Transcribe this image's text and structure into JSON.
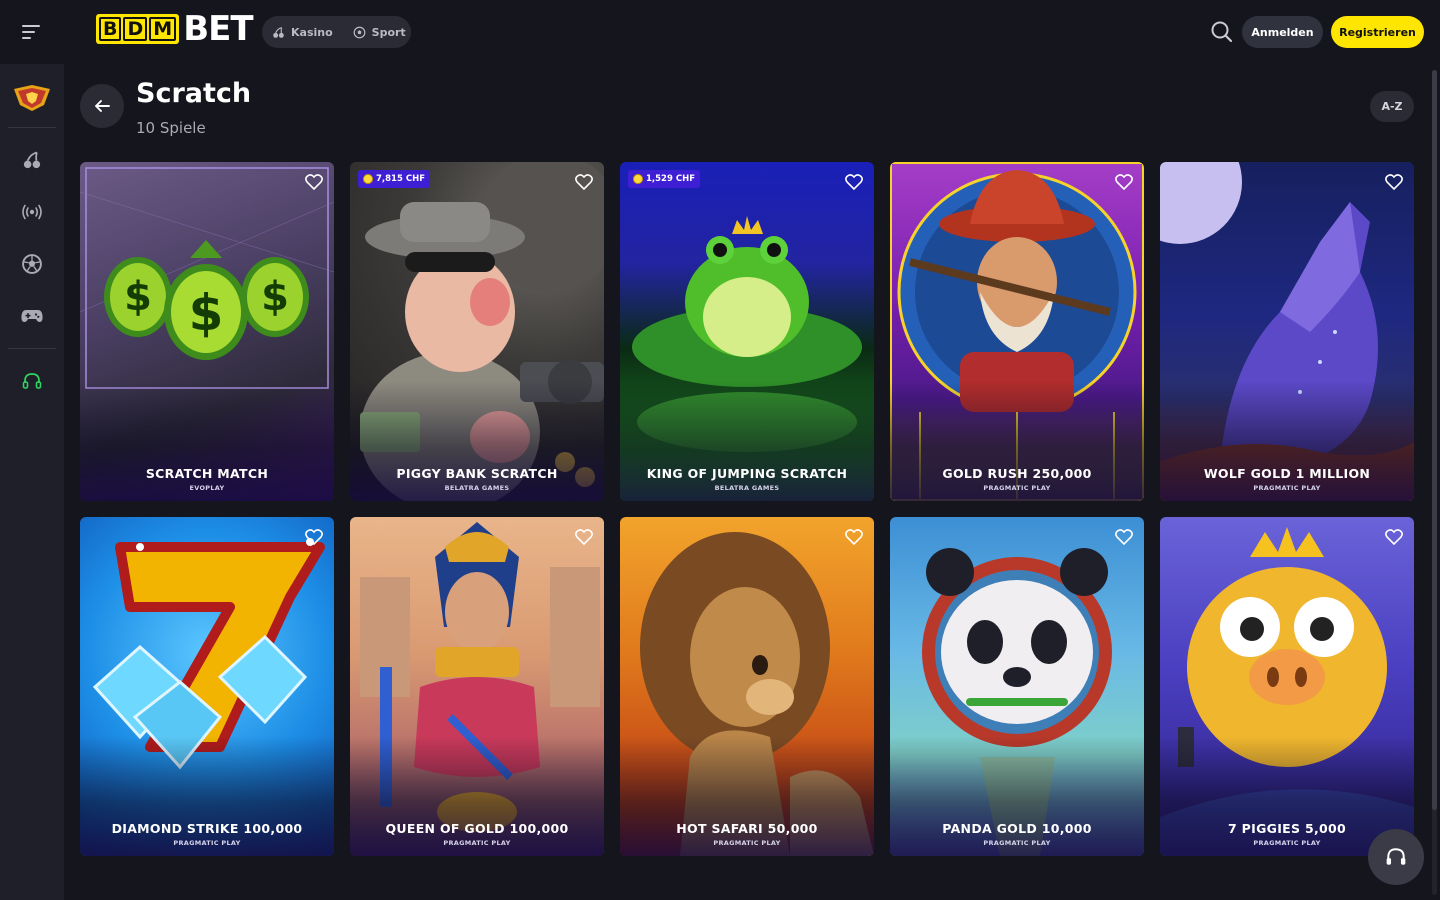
{
  "header": {
    "logo_prefix": [
      "B",
      "D",
      "M"
    ],
    "logo_suffix": "BET",
    "nav": [
      {
        "label": "Kasino",
        "icon": "cherry-icon"
      },
      {
        "label": "Sport",
        "icon": "soccer-ball-icon"
      }
    ],
    "login_label": "Anmelden",
    "register_label": "Registrieren"
  },
  "sidebar": {
    "items": [
      "promo-badge-icon",
      "cherry-icon",
      "live-broadcast-icon",
      "soccer-ball-icon",
      "gamepad-icon",
      "headset-icon"
    ]
  },
  "page": {
    "title": "Scratch",
    "subtitle": "10 Spiele",
    "sort_label": "A-Z"
  },
  "games": [
    {
      "name": "SCRATCH MATCH",
      "provider": "EVOPLAY",
      "jackpot": ""
    },
    {
      "name": "PIGGY BANK SCRATCH",
      "provider": "BELATRA GAMES",
      "jackpot": "7,815 CHF"
    },
    {
      "name": "KING OF JUMPING SCRATCH",
      "provider": "BELATRA GAMES",
      "jackpot": "1,529 CHF"
    },
    {
      "name": "GOLD RUSH 250,000",
      "provider": "PRAGMATIC PLAY",
      "jackpot": ""
    },
    {
      "name": "WOLF GOLD 1 MILLION",
      "provider": "PRAGMATIC PLAY",
      "jackpot": ""
    },
    {
      "name": "DIAMOND STRIKE 100,000",
      "provider": "PRAGMATIC PLAY",
      "jackpot": ""
    },
    {
      "name": "QUEEN OF GOLD 100,000",
      "provider": "PRAGMATIC PLAY",
      "jackpot": ""
    },
    {
      "name": "HOT SAFARI 50,000",
      "provider": "PRAGMATIC PLAY",
      "jackpot": ""
    },
    {
      "name": "PANDA GOLD 10,000",
      "provider": "PRAGMATIC PLAY",
      "jackpot": ""
    },
    {
      "name": "7 PIGGIES 5,000",
      "provider": "PRAGMATIC PLAY",
      "jackpot": ""
    }
  ],
  "colors": {
    "accent": "#ffe600",
    "background": "#15161d",
    "sidebar": "#1e1f28",
    "jackpot_badge": "#3e1fd4"
  }
}
